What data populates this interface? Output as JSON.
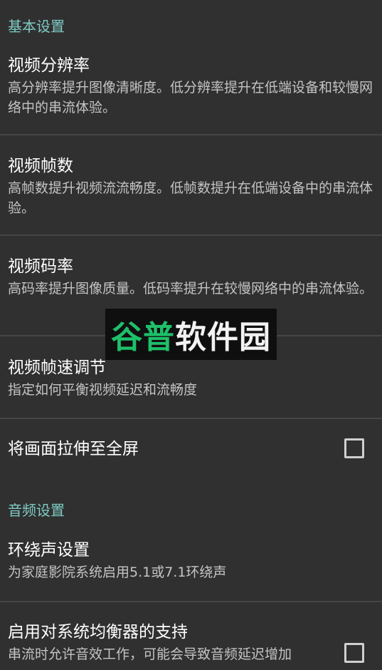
{
  "sections": {
    "basic_header": "基本设置",
    "audio_header": "音频设置"
  },
  "prefs": {
    "resolution": {
      "title": "视频分辨率",
      "summary": "高分辨率提升图像清晰度。低分辨率提升在低端设备和较慢网络中的串流体验。"
    },
    "framerate": {
      "title": "视频帧数",
      "summary": "高帧数提升视频流流畅度。低帧数提升在低端设备中的串流体验。"
    },
    "bitrate": {
      "title": "视频码率",
      "summary": "高码率提升图像质量。低码率提升在较慢网络中的串流体验。"
    },
    "frame_pacing": {
      "title": "视频帧速调节",
      "summary": "指定如何平衡视频延迟和流畅度"
    },
    "stretch": {
      "title": "将画面拉伸至全屏",
      "checked": false
    },
    "surround": {
      "title": "环绕声设置",
      "summary": "为家庭影院系统启用5.1或7.1环绕声"
    },
    "equalizer": {
      "title": "启用对系统均衡器的支持",
      "summary": "串流时允许音效工作，可能会导致音频延迟增加",
      "checked": false
    }
  },
  "watermark": {
    "part1": "谷普",
    "part2": "软件园"
  },
  "colors": {
    "background": "#303030",
    "section_header": "#7fcbc4",
    "divider": "#454545",
    "summary_text": "#c4c4c4",
    "watermark_green": "#1ec06a"
  }
}
